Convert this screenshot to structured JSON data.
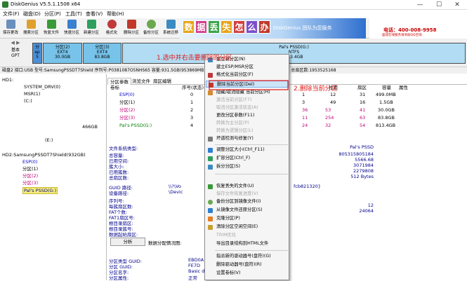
{
  "window": {
    "title": "DiskGenius V5.5.1.1508 x64",
    "minimize_glyph": "—",
    "maximize_glyph": "☐",
    "close_glyph": "✕"
  },
  "menu": [
    "文件(F)",
    "磁盘(D)",
    "分区(P)",
    "工具(T)",
    "查看(V)",
    "帮助(H)"
  ],
  "toolbar": [
    {
      "label": "保存更改",
      "icon": "save-icon",
      "color": "#6b8fbf"
    },
    {
      "label": "搜索分区",
      "icon": "search-partition-icon",
      "color": "#e0a030"
    },
    {
      "label": "恢复文件",
      "icon": "recover-files-icon",
      "color": "#3a9a3a"
    },
    {
      "label": "快速分区",
      "icon": "quick-partition-icon",
      "color": "#3a7fd0"
    },
    {
      "label": "新建分区",
      "icon": "new-partition-icon",
      "color": "#2f9f5f"
    },
    {
      "label": "格式化",
      "icon": "format-icon",
      "color": "#c03a3a"
    },
    {
      "label": "删除分区",
      "icon": "delete-partition-icon",
      "color": "#c0392b"
    },
    {
      "label": "备份分区",
      "icon": "backup-partition-icon",
      "color": "#6aa84f"
    },
    {
      "label": "系统迁移",
      "icon": "migrate-system-icon",
      "color": "#3b8bc2"
    }
  ],
  "banner": {
    "chars": [
      "数",
      "据",
      "丢",
      "失",
      "怎",
      "么",
      "办"
    ],
    "char_colors": [
      "#e8a317",
      "#d23f8b",
      "#3ba34a",
      "#e8a317",
      "#d23f3f",
      "#7a4fc9",
      "#c0392b"
    ],
    "slogan": "DiskGenius 团队为您服务",
    "phone": "电话：400-008-9958",
    "note": "盛成在线服务请添加QQ咨询"
  },
  "disk_map": {
    "nav_glyph": "◀ ▶",
    "type_label": "基本",
    "style_label": "GPT",
    "segments": [
      {
        "name": "分",
        "fs": "ap",
        "size": "5",
        "color": "#4a90d9"
      },
      {
        "name": "分区(2)",
        "fs": "EXT4",
        "size": "30.0GB",
        "color": "#77c3ea"
      },
      {
        "name": "分区(3)",
        "fs": "EXT4",
        "size": "83.8GB",
        "color": "#77c3ea"
      },
      {
        "name": "Pal's PSSD(G:)",
        "fs": "NTFS",
        "size": "813.4GB",
        "color": "#b1dcf3"
      }
    ]
  },
  "disk_info": "磁盘2 接口:USB  型号:SamsungPSSDT7Shield  序列号:P0381087O5NHS65  容量:931.5GB(953869MB)  柱面数:121601  磁头数:255  每道扇区数:63  总扇区数:1953525168",
  "tree": {
    "hd1_label": "HD1:",
    "hd1_items": [
      "SYSTEM_DRV(0)",
      "MSR(1)",
      "(C:)",
      "(E:)"
    ],
    "hd1_size": "466GB",
    "hd2_label": "HD2:SamsungPSSDT7Shield(932GB)",
    "hd2_items": [
      "ESP(0)",
      "分区(1)",
      "分区(2)",
      "分区(3)",
      "Pal's PSSD(G:)"
    ]
  },
  "tabs": [
    "分区参数",
    "浏览文件",
    "扇区编辑"
  ],
  "columns": {
    "volume": "卷标",
    "seq": "序号(状态)",
    "cyl": "柱面",
    "head": "磁头",
    "sector": "扇区",
    "capacity": "容量",
    "attr": "属性"
  },
  "partitions": [
    {
      "name": "ESP(0)",
      "seq": "0",
      "cyl": "1",
      "head": "12",
      "sector": "31",
      "capacity": "499.0MB"
    },
    {
      "name": "分区(1)",
      "seq": "1",
      "cyl": "3",
      "head": "49",
      "sector": "16",
      "capacity": "1.5GB"
    },
    {
      "name": "分区(2)",
      "seq": "2",
      "cyl": "36",
      "head": "53",
      "sector": "41",
      "capacity": "30.0GB"
    },
    {
      "name": "分区(3)",
      "seq": "3",
      "cyl": "11",
      "head": "254",
      "sector": "63",
      "capacity": "83.8GB"
    },
    {
      "name": "Pal's PSSD(G:)",
      "seq": "4",
      "cyl": "24",
      "head": "32",
      "sector": "54",
      "capacity": "813.4GB"
    }
  ],
  "fs_info": {
    "type_label": "文件系统类型:",
    "volume": "Pal's PSSD",
    "rows": [
      {
        "label": "总容量:",
        "value": "805315805184"
      },
      {
        "label": "已用空间:",
        "value": "5566.68"
      },
      {
        "label": "簇大小:",
        "value": "3071984"
      },
      {
        "label": "已用簇数:",
        "value": "2279808"
      },
      {
        "label": "总扇区数:",
        "value": "512 Bytes"
      },
      {
        "label": "GUID 路径:",
        "value": "\\\\?\\Vo"
      },
      {
        "label": "设备路径:",
        "value": "\\Devic"
      }
    ],
    "guid_tail": "fcb821320}",
    "rows2": [
      {
        "label": "序列号:",
        "value": ""
      },
      {
        "label": "每簇扇区数:",
        "value": "12"
      },
      {
        "label": "FAT个数:",
        "value": "24064"
      },
      {
        "label": "FAT1扇区号:",
        "value": ""
      },
      {
        "label": "根目录扇区:",
        "value": ""
      },
      {
        "label": "根目录簇号:",
        "value": ""
      },
      {
        "label": "数据起始扇区:",
        "value": ""
      }
    ],
    "analyze_button": "分析",
    "alloc_label": "数据分配情况图:",
    "rows3": [
      {
        "label": "分区类型 GUID:",
        "value": "EBD0A"
      },
      {
        "label": "分区 GUID:",
        "value": "FE7D"
      },
      {
        "label": "分区名字:",
        "value": "Basic d"
      },
      {
        "label": "分区属性:",
        "value": "正常"
      }
    ]
  },
  "context_menu": [
    {
      "label": "建立新分区(N)",
      "enabled": true
    },
    {
      "label": "建立ESP/MSR分区",
      "enabled": true
    },
    {
      "label": "格式化当前分区(F)",
      "enabled": true
    },
    {
      "label": "删除当前分区(Del)",
      "enabled": true,
      "highlight": true
    },
    {
      "label": "隐藏/取消隐藏 当前分区(H)",
      "enabled": true
    },
    {
      "label": "激活当前分区(F7)",
      "enabled": false
    },
    {
      "label": "取消分区激活状态(A)",
      "enabled": false
    },
    {
      "label": "更改分区参数(F11)",
      "enabled": true
    },
    {
      "label": "转换为主分区(P)",
      "enabled": false
    },
    {
      "label": "转换为逻辑分区(L)",
      "enabled": false
    },
    {
      "label": "坏道检测与修复(Y)",
      "enabled": true
    },
    {
      "label": "调整分区大小(Ctrl_F11)",
      "enabled": true
    },
    {
      "label": "扩容分区(Ctrl_F)",
      "enabled": true
    },
    {
      "label": "拆分分区(S)",
      "enabled": true
    },
    {
      "label": "恢复丢失的文件(U)",
      "enabled": true
    },
    {
      "label": "保存文件恢复进度(V)",
      "enabled": false
    },
    {
      "label": "备份分区到镜像文件(I)",
      "enabled": true
    },
    {
      "label": "从镜像文件还原分区(S)",
      "enabled": true
    },
    {
      "label": "克隆分区(P)",
      "enabled": true
    },
    {
      "label": "清除分区空闲空间(E)",
      "enabled": true
    },
    {
      "label": "TRIM优化",
      "enabled": false
    },
    {
      "label": "导出目录结构到HTML文件",
      "enabled": true
    },
    {
      "label": "指派新的驱动器号(盘符)(G)",
      "enabled": true
    },
    {
      "label": "删除驱动器号(盘符)(R)",
      "enabled": true
    },
    {
      "label": "设置卷标(V)",
      "enabled": true
    }
  ],
  "annotations": {
    "step1": "1.选中并右击要删除的分区",
    "step2": "2.删除当前分区"
  }
}
